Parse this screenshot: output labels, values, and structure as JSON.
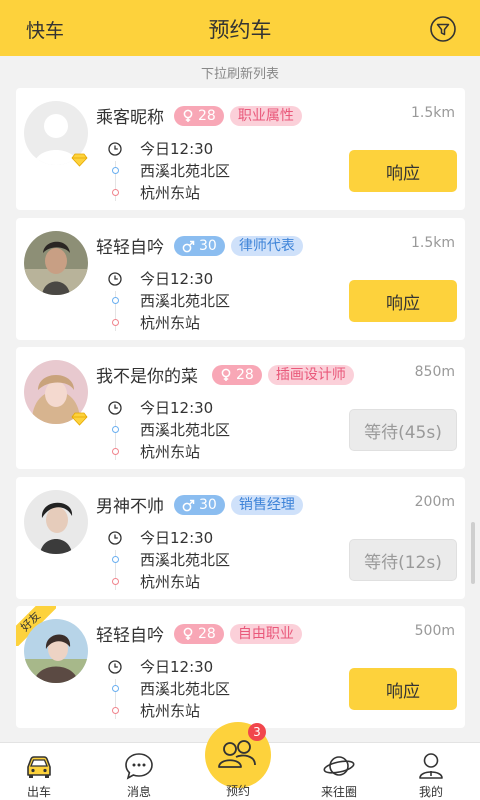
{
  "header": {
    "left_label": "快车",
    "title": "预约车",
    "filter_icon": "filter-icon"
  },
  "hint": "下拉刷新列表",
  "orders": [
    {
      "name": "乘客昵称",
      "gender": "female",
      "age": "28",
      "job": "职业属性",
      "distance": "1.5km",
      "time": "今日12:30",
      "from": "西溪北苑北区",
      "to": "杭州东站",
      "action": "响应",
      "action_type": "respond",
      "vip": true,
      "friend": false,
      "avatar": "placeholder"
    },
    {
      "name": "轻轻自吟",
      "gender": "male",
      "age": "30",
      "job": "律师代表",
      "distance": "1.5km",
      "time": "今日12:30",
      "from": "西溪北苑北区",
      "to": "杭州东站",
      "action": "响应",
      "action_type": "respond",
      "vip": false,
      "friend": false,
      "avatar": "photo"
    },
    {
      "name": "我不是你的菜",
      "gender": "female",
      "age": "28",
      "job": "插画设计师",
      "distance": "850m",
      "time": "今日12:30",
      "from": "西溪北苑北区",
      "to": "杭州东站",
      "action": "等待(45s)",
      "action_type": "wait",
      "vip": true,
      "friend": false,
      "avatar": "photo"
    },
    {
      "name": "男神不帅",
      "gender": "male",
      "age": "30",
      "job": "销售经理",
      "distance": "200m",
      "time": "今日12:30",
      "from": "西溪北苑北区",
      "to": "杭州东站",
      "action": "等待(12s)",
      "action_type": "wait",
      "vip": false,
      "friend": false,
      "avatar": "photo"
    },
    {
      "name": "轻轻自吟",
      "gender": "female",
      "age": "28",
      "job": "自由职业",
      "distance": "500m",
      "time": "今日12:30",
      "from": "西溪北苑北区",
      "to": "杭州东站",
      "action": "响应",
      "action_type": "respond",
      "vip": false,
      "friend": true,
      "friend_label": "好友",
      "avatar": "photo"
    }
  ],
  "tabs": [
    {
      "label": "出车",
      "icon": "car-icon"
    },
    {
      "label": "消息",
      "icon": "message-icon"
    },
    {
      "label": "预约",
      "icon": "group-icon",
      "badge": "3"
    },
    {
      "label": "来往圈",
      "icon": "planet-icon"
    },
    {
      "label": "我的",
      "icon": "profile-icon"
    }
  ],
  "colors": {
    "accent": "#fdd23c",
    "female": "#f8a7b6",
    "male": "#8bbdf0",
    "badge": "#f1464c"
  }
}
